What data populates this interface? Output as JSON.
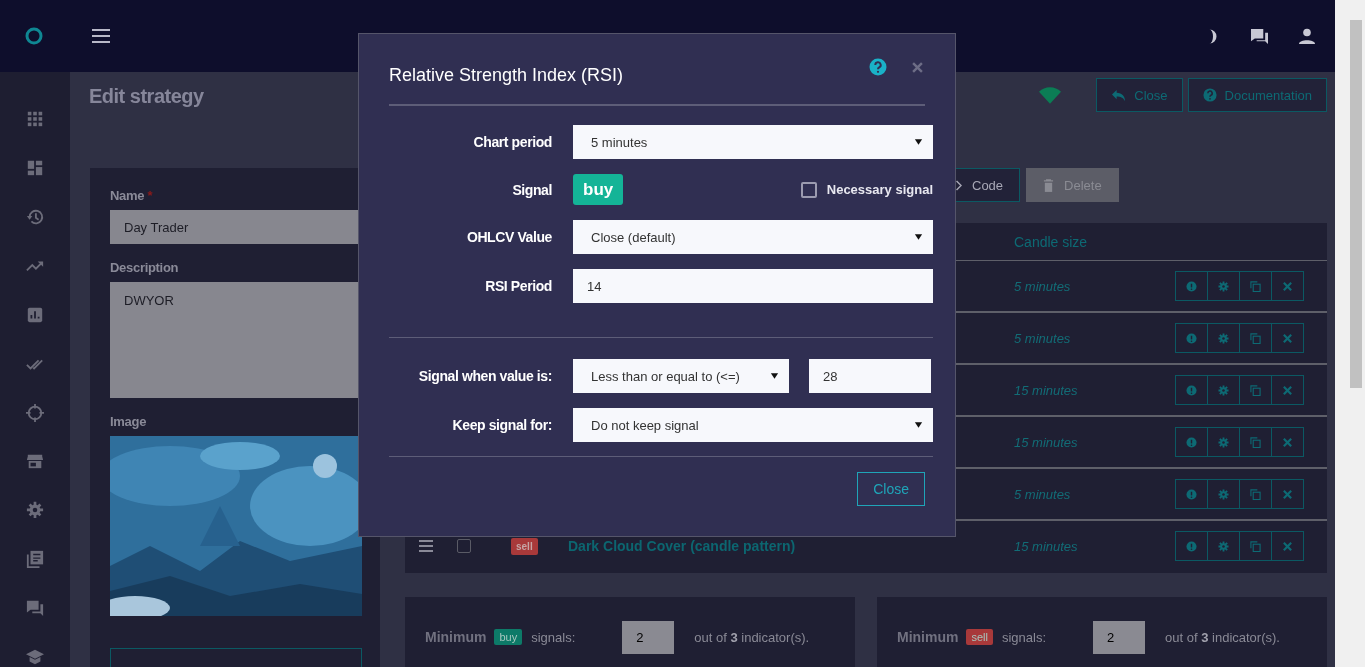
{
  "page": {
    "title": "Edit strategy",
    "buttons": [
      {
        "kind": "back",
        "label": "Close"
      },
      {
        "kind": "help",
        "label": "Documentation"
      }
    ]
  },
  "form": {
    "name_label": "Name",
    "required_mark": "*",
    "name_value": "Day Trader",
    "description_label": "Description",
    "description_value": "DWYOR",
    "image_label": "Image"
  },
  "toolbar": [
    {
      "kind": "code",
      "label": "Code",
      "disabled": false
    },
    {
      "kind": "delete",
      "label": "Delete",
      "disabled": true
    }
  ],
  "table": {
    "columns": [
      {
        "label": "Candle size"
      }
    ],
    "rows": [
      {
        "candle_size": "5 minutes"
      },
      {
        "candle_size": "5 minutes"
      },
      {
        "candle_size": "15 minutes"
      },
      {
        "candle_size": "15 minutes"
      },
      {
        "candle_size": "5 minutes"
      },
      {
        "checked": false,
        "signal": "sell",
        "name": "Dark Cloud Cover (candle pattern)",
        "candle_size": "15 minutes"
      }
    ]
  },
  "minimums": [
    {
      "signal": "buy",
      "text": "Minimum",
      "signals_label": "signals:",
      "value": "2",
      "summary": "out of **3** indicator(s)."
    },
    {
      "signal": "sell",
      "text": "Minimum",
      "signals_label": "signals:",
      "value": "2",
      "summary": "out of **3** indicator(s)."
    }
  ],
  "modal": {
    "title": "Relative Strength Index (RSI)",
    "sections": [
      [
        {
          "kind": "select",
          "label": "Chart period",
          "value": "5 minutes"
        },
        {
          "kind": "signal",
          "label": "Signal",
          "signal": "buy",
          "checkbox_label": "Necessary signal",
          "checked": false
        },
        {
          "kind": "select",
          "label": "OHLCV Value",
          "value": "Close (default)"
        },
        {
          "kind": "input",
          "label": "RSI Period",
          "value": "14"
        }
      ],
      [
        {
          "kind": "compare",
          "label": "Signal when value is:",
          "value": "Less than or equal to (<=)",
          "threshold": "28"
        },
        {
          "kind": "select",
          "label": "Keep signal for:",
          "value": "Do not keep signal"
        }
      ]
    ],
    "button": "Close"
  }
}
